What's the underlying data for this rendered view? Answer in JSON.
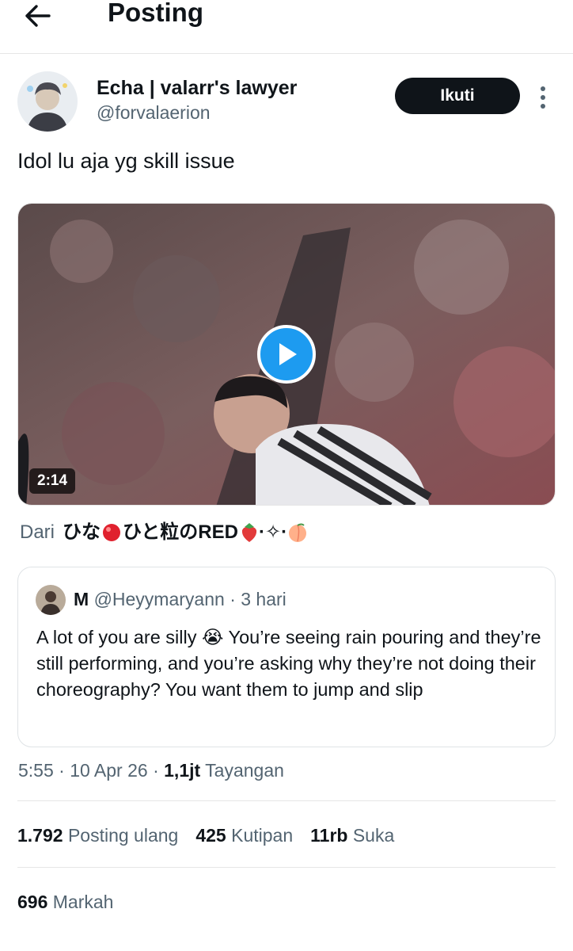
{
  "header": {
    "title": "Posting",
    "back_icon": "arrow-left-icon"
  },
  "author": {
    "name": "Echa | valarr's lawyer",
    "handle": "@forvalaerion",
    "follow_label": "Ikuti",
    "more_icon": "more-vertical-icon"
  },
  "tweet": {
    "text": "Idol lu aja yg skill issue"
  },
  "media": {
    "duration": "2:14",
    "play_icon": "play-icon"
  },
  "source": {
    "label": "Dari",
    "prefix": "ひな",
    "middle": "ひと粒のRED",
    "sep": "·",
    "sparkle": "✧"
  },
  "quote": {
    "name": "M",
    "handle": "@Heyymaryann",
    "time": "3 hari",
    "text": "A lot of you are silly 😭 You’re seeing rain pouring and they’re still performing, and you’re asking why they’re not doing their choreography? You want them to jump and slip"
  },
  "meta": {
    "time": "5:55",
    "date": "10 Apr 26",
    "views": "1,1jt",
    "views_label": "Tayangan"
  },
  "stats": {
    "reposts": "1.792",
    "reposts_label": "Posting ulang",
    "quotes": "425",
    "quotes_label": "Kutipan",
    "likes": "11rb",
    "likes_label": "Suka",
    "bookmarks": "696",
    "bookmarks_label": "Markah"
  },
  "colors": {
    "accent": "#1d9bf0",
    "text": "#0f1419",
    "muted": "#536471",
    "button": "#0f1419"
  }
}
